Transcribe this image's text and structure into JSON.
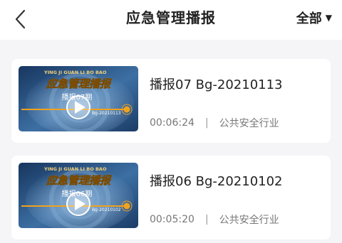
{
  "header": {
    "title": "应急管理播报",
    "filter_label": "全部",
    "filter_caret": "▼"
  },
  "videos": [
    {
      "title": "播报07 Bg-20210113",
      "duration": "00:06:24",
      "separator": "|",
      "category": "公共安全行业",
      "thumb_headline": "应急管理播报",
      "thumb_banner": "YING JI GUAN LI BO BAO",
      "thumb_episode": "播报07期",
      "thumb_date": "Bg-20210113"
    },
    {
      "title": "播报06 Bg-20210102",
      "duration": "00:05:20",
      "separator": "|",
      "category": "公共安全行业",
      "thumb_headline": "应急管理播报",
      "thumb_banner": "YING JI GUAN LI BO BAO",
      "thumb_episode": "播报06期",
      "thumb_date": "Bg-20210102"
    }
  ],
  "icons": {
    "back": "back-chevron-icon",
    "play": "play-icon"
  },
  "colors": {
    "thumb_bg_dark": "#1b3f6e",
    "thumb_bg_light": "#5a8fc2",
    "thumb_accent": "#f0a21e"
  }
}
